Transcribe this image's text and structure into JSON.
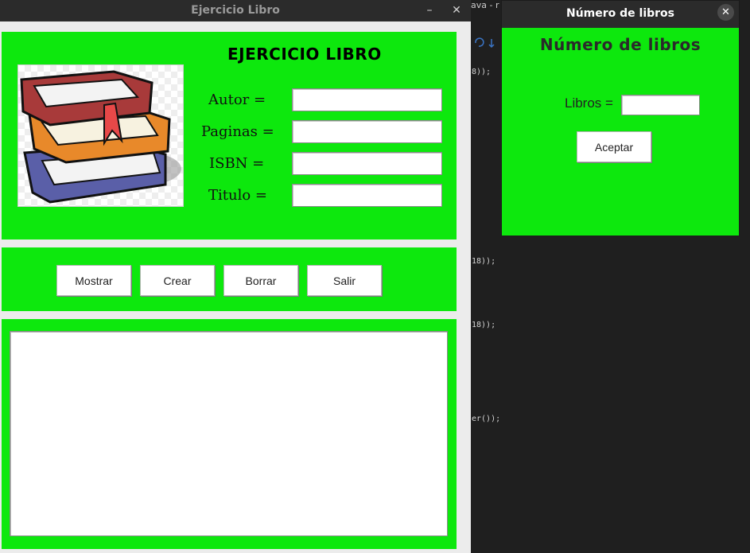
{
  "background_ide": {
    "title_fragment": "ava - r",
    "code_fragments": [
      "8));",
      "18));",
      "18));",
      "er());"
    ]
  },
  "main_window": {
    "title": "Ejercicio Libro",
    "minimize_glyph": "–",
    "close_glyph": "✕",
    "heading": "EJERCICIO LIBRO",
    "image_icon": "books-icon",
    "fields": {
      "autor": {
        "label": "Autor =",
        "value": ""
      },
      "paginas": {
        "label": "Paginas =",
        "value": ""
      },
      "isbn": {
        "label": "ISBN =",
        "value": ""
      },
      "titulo": {
        "label": "Titulo =",
        "value": ""
      }
    },
    "buttons": {
      "mostrar": "Mostrar",
      "crear": "Crear",
      "borrar": "Borrar",
      "salir": "Salir"
    },
    "output_text": ""
  },
  "dialog": {
    "title": "Número de libros",
    "close_glyph": "✕",
    "heading": "Número de libros",
    "libros_label": "Libros =",
    "libros_value": "",
    "accept_label": "Aceptar"
  },
  "colors": {
    "panel_green": "#0de80d",
    "titlebar": "#2b2b2b",
    "window_bg": "#ececec"
  }
}
